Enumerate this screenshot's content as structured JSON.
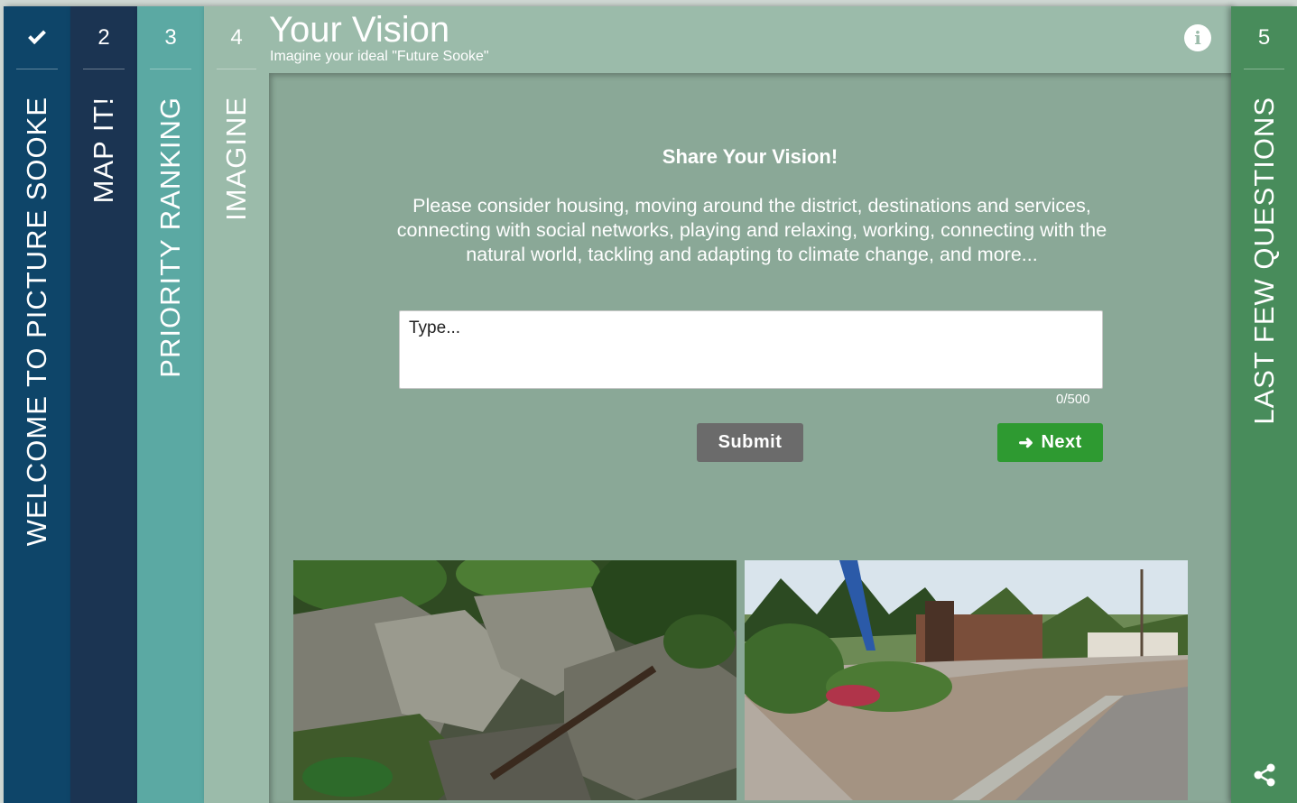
{
  "tabs": [
    {
      "num": "",
      "completed": true,
      "label": "WELCOME TO PICTURE SOOKE"
    },
    {
      "num": "2",
      "label": "MAP IT!"
    },
    {
      "num": "3",
      "label": "PRIORITY RANKING"
    },
    {
      "num": "4",
      "label": "IMAGINE"
    },
    {
      "num": "5",
      "label": "LAST FEW QUESTIONS"
    }
  ],
  "header": {
    "title": "Your Vision",
    "subtitle": "Imagine your ideal \"Future Sooke\""
  },
  "main": {
    "heading": "Share Your Vision!",
    "description": "Please consider housing, moving around the district, destinations and services, connecting with social networks, playing and relaxing, working, connecting with the natural world, tackling and adapting to climate change, and more...",
    "input_placeholder": "Type...",
    "counter": "0/500",
    "submit_label": "Submit",
    "next_label": "Next"
  },
  "colors": {
    "tab1": "#0e4569",
    "tab2": "#1b3452",
    "tab3": "#5ba9a3",
    "tab4": "#9bbbaa",
    "tab5": "#488c5b",
    "panel": "#8aa897",
    "next_button": "#2e9a31",
    "submit_button": "#6b6b6b"
  }
}
